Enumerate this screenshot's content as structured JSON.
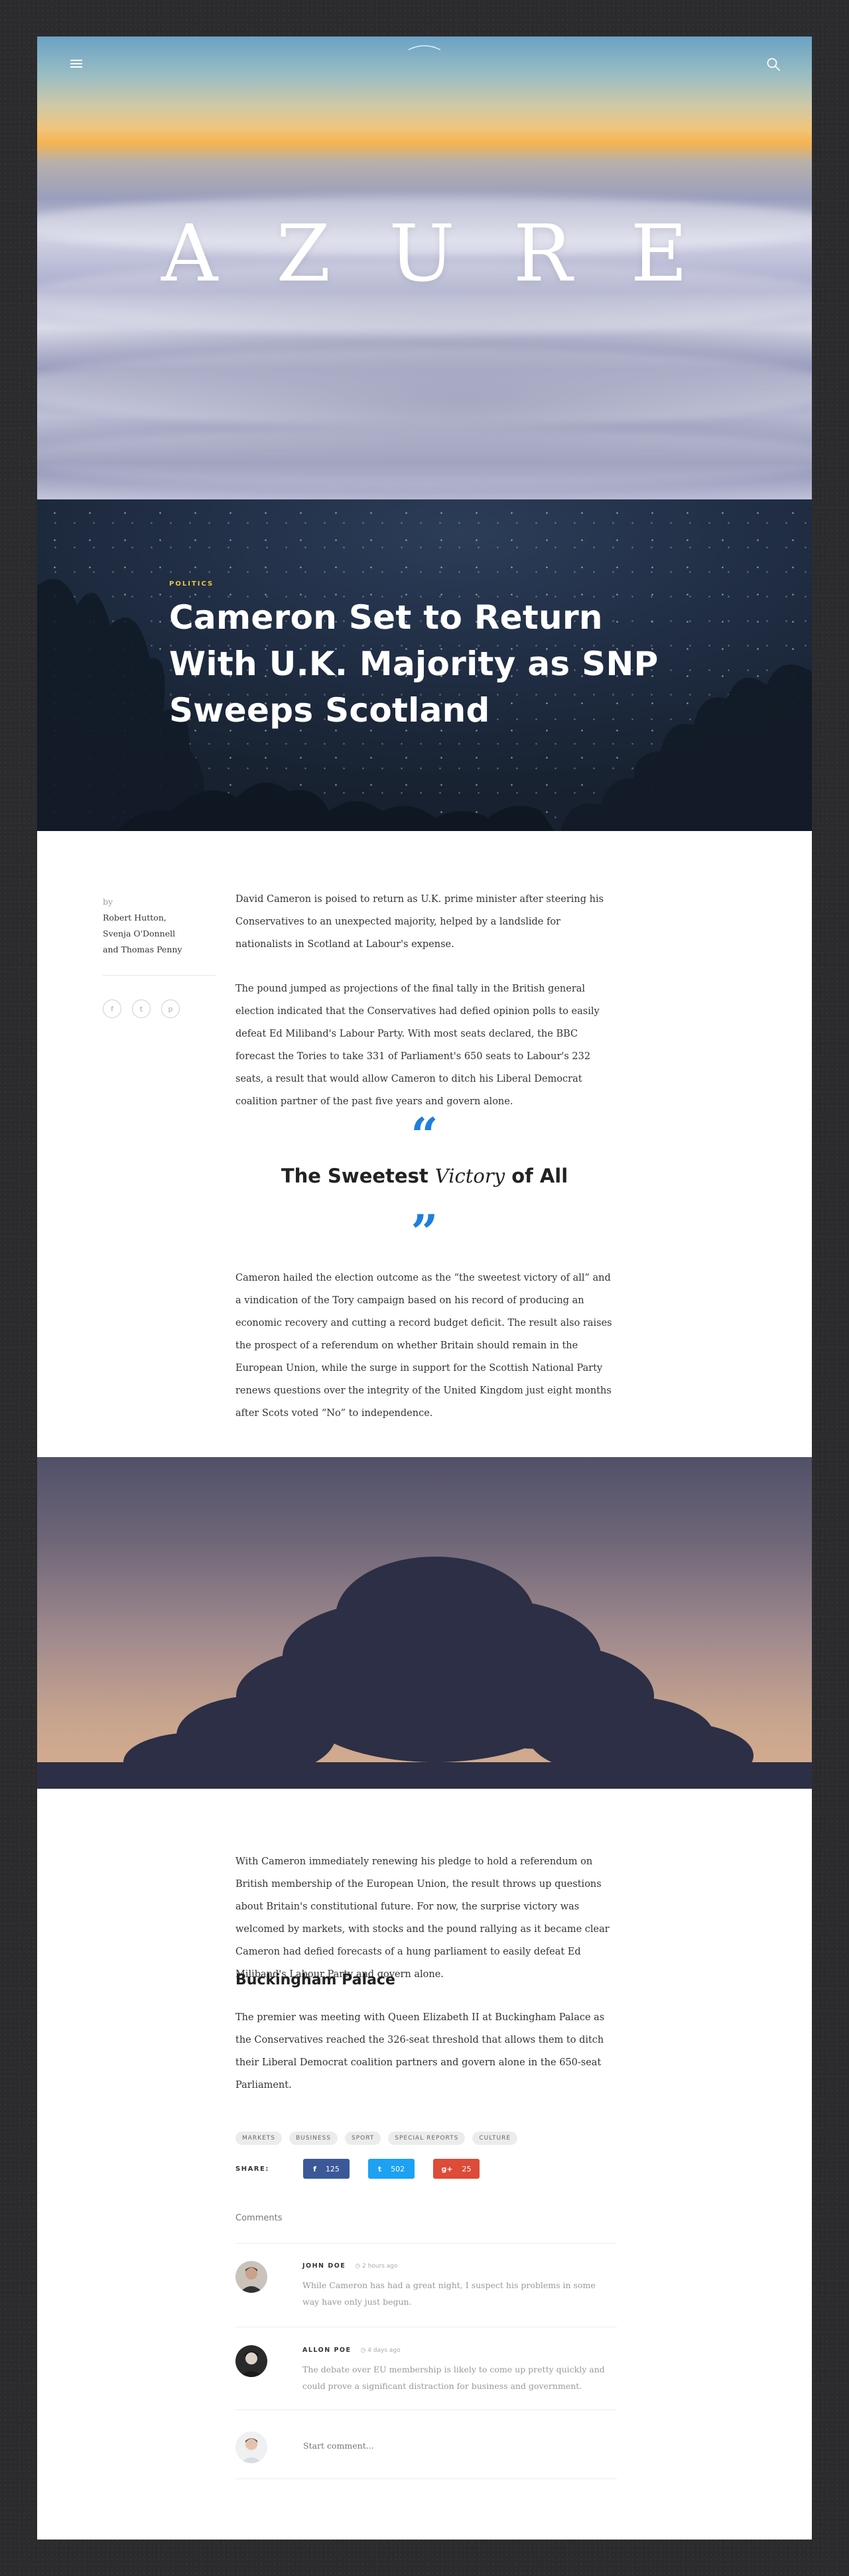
{
  "hero": {
    "brand": "AZURE",
    "menu_icon": "hamburger-icon",
    "search_icon": "search-icon"
  },
  "article": {
    "kicker": "POLITICS",
    "headline": "Cameron Set to Return With U.K. Majority as SNP Sweeps Scotland",
    "byline_prefix": "by",
    "authors": [
      "Robert Hutton,",
      "Svenja O'Donnell",
      "and Thomas Penny"
    ],
    "byline_social": [
      "f",
      "t",
      "p"
    ],
    "paragraphs": [
      "David Cameron is poised to return as U.K. prime minister after steering his Conservatives to an unexpected majority, helped by a landslide for nationalists in Scotland at Labour's expense.",
      "The pound jumped as projections of the final tally in the British general election indicated that the Conservatives had defied opinion polls to easily defeat Ed Miliband's Labour Party. With most seats declared, the BBC forecast the Tories to take 331 of Parliament's 650 seats to Labour's 232 seats, a result that would allow Cameron to ditch his Liberal Democrat coalition partner of the past five years and govern alone.",
      "Cameron hailed the election outcome as the “the sweetest victory of all” and a vindication of the Tory campaign based on his record of producing an economic recovery and cutting a record budget deficit. The result also raises the prospect of a referendum on whether Britain should remain in the European Union, while the surge in support for the Scottish National Party renews questions over the integrity of the United Kingdom just eight months after Scots voted “No” to independence.",
      "With Cameron immediately renewing his pledge to hold a referendum on British membership of the European Union, the result throws up questions about Britain's constitutional future. For now, the surprise victory was welcomed by markets, with stocks and the pound rallying as it became clear Cameron had defied forecasts of a hung parliament to easily defeat Ed Miliband's Labour Party and govern alone.",
      "The premier was meeting with Queen Elizabeth II at Buckingham Palace as the Conservatives reached the 326-seat threshold that allows them to ditch their Liberal Democrat coalition partners and govern alone in the 650-seat Parliament."
    ],
    "pull_quote": {
      "open_mark": "“",
      "close_mark": "”",
      "before": "The Sweetest ",
      "em": "Victory",
      "after": " of All"
    },
    "subheading": "Buckingham Palace",
    "tags": [
      "MARKETS",
      "BUSINESS",
      "SPORT",
      "SPECIAL REPORTS",
      "CULTURE"
    ],
    "share": {
      "label": "SHARE:",
      "buttons": [
        {
          "network": "facebook",
          "icon": "f",
          "count": "125",
          "color": "#3b5998"
        },
        {
          "network": "twitter",
          "icon": "t",
          "count": "502",
          "color": "#1da1f2"
        },
        {
          "network": "google-plus",
          "icon": "g+",
          "count": "25",
          "color": "#dd4b39"
        }
      ]
    }
  },
  "comments": {
    "title": "Comments",
    "items": [
      {
        "name": "JOHN DOE",
        "time": "2 hours ago",
        "text": "While Cameron has had a great night, I suspect his problems in some way have only just begun."
      },
      {
        "name": "ALLON POE",
        "time": "4 days ago",
        "text": "The debate over EU membership is likely to come up pretty quickly and could prove a significant distraction for business and government."
      }
    ],
    "input_placeholder": "Start comment..."
  },
  "colors": {
    "accent": "#1f7fdd",
    "kicker": "#e8c547",
    "facebook": "#3b5998",
    "twitter": "#1da1f2",
    "google_plus": "#dd4b39"
  }
}
